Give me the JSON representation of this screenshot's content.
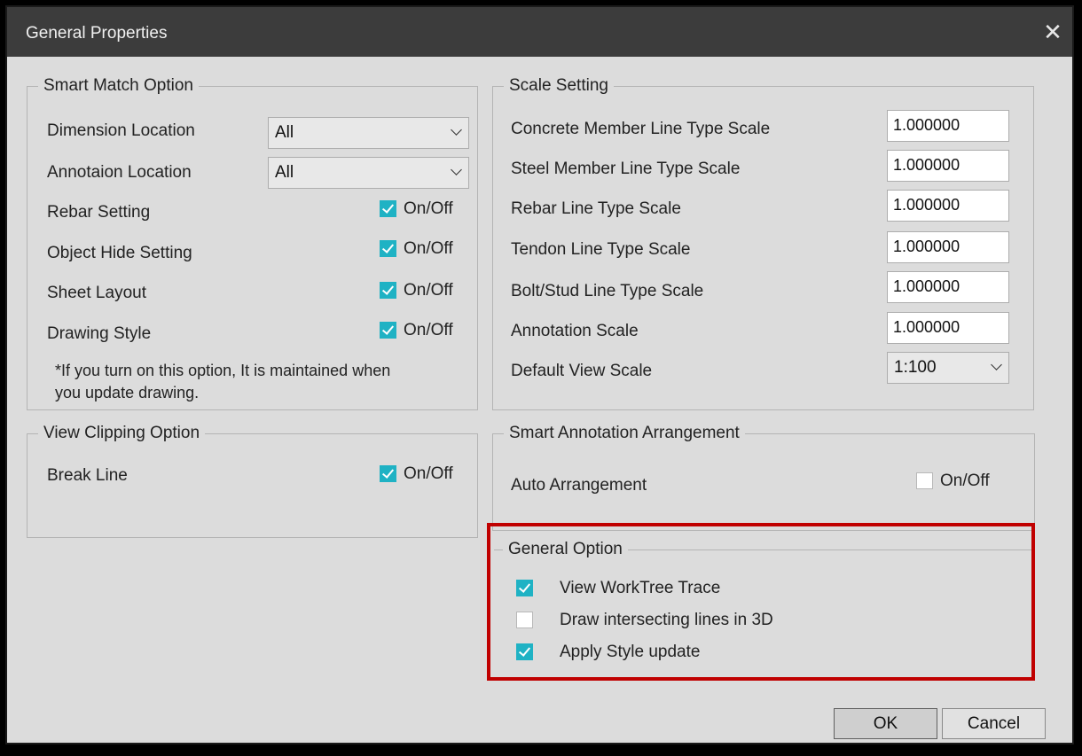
{
  "window": {
    "title": "General Properties"
  },
  "smart_match": {
    "legend": "Smart Match Option",
    "dimension_location": {
      "label": "Dimension Location",
      "value": "All"
    },
    "annotation_location": {
      "label": "Annotaion Location",
      "value": "All"
    },
    "toggles": [
      {
        "label": "Rebar Setting",
        "state_label": "On/Off",
        "checked": true
      },
      {
        "label": "Object Hide Setting",
        "state_label": "On/Off",
        "checked": true
      },
      {
        "label": "Sheet Layout",
        "state_label": "On/Off",
        "checked": true
      },
      {
        "label": "Drawing Style",
        "state_label": "On/Off",
        "checked": true
      }
    ],
    "note_line1": "*If you turn on this option, It is maintained when",
    "note_line2": "you update drawing."
  },
  "scale_setting": {
    "legend": "Scale Setting",
    "rows": [
      {
        "label": "Concrete Member Line Type Scale",
        "value": "1.000000"
      },
      {
        "label": "Steel Member Line Type Scale",
        "value": "1.000000"
      },
      {
        "label": "Rebar Line Type Scale",
        "value": "1.000000"
      },
      {
        "label": "Tendon Line Type Scale",
        "value": "1.000000"
      },
      {
        "label": "Bolt/Stud Line Type Scale",
        "value": "1.000000"
      },
      {
        "label": "Annotation Scale",
        "value": "1.000000"
      }
    ],
    "default_view_scale": {
      "label": "Default View Scale",
      "value": "1:100"
    }
  },
  "view_clipping": {
    "legend": "View Clipping Option",
    "break_line": {
      "label": "Break Line",
      "state_label": "On/Off",
      "checked": true
    }
  },
  "smart_annotation": {
    "legend": "Smart Annotation Arrangement",
    "auto_arrangement": {
      "label": "Auto Arrangement",
      "state_label": "On/Off",
      "checked": false
    }
  },
  "general_option": {
    "legend": "General Option",
    "items": [
      {
        "label": "View WorkTree Trace",
        "checked": true
      },
      {
        "label": "Draw intersecting lines in 3D",
        "checked": false
      },
      {
        "label": "Apply Style update",
        "checked": true
      }
    ]
  },
  "buttons": {
    "ok": "OK",
    "cancel": "Cancel"
  },
  "colors": {
    "accent_check": "#1fb2c4",
    "highlight": "#c00000",
    "titlebar": "#3c3c3c"
  }
}
